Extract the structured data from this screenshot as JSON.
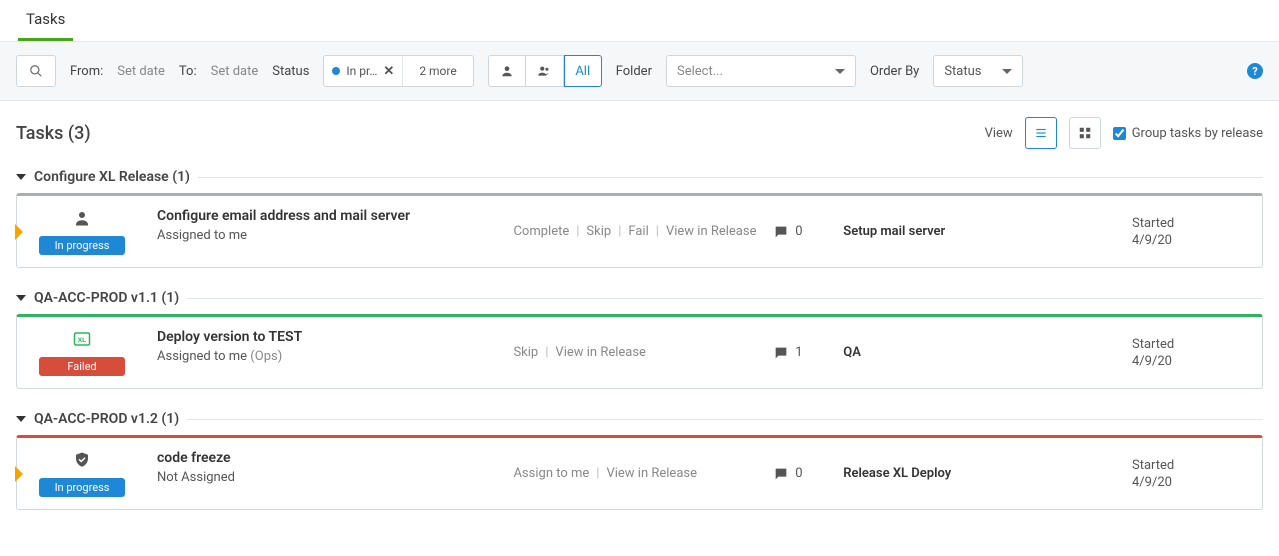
{
  "tab": {
    "label": "Tasks"
  },
  "filters": {
    "from_label": "From:",
    "from_value": "Set date",
    "to_label": "To:",
    "to_value": "Set date",
    "status_label": "Status",
    "status_chip": "In pr…",
    "status_chip_color": "#1e88d6",
    "more_chip": "2 more",
    "assign_all_label": "All",
    "folder_label": "Folder",
    "folder_placeholder": "Select...",
    "orderby_label": "Order By",
    "orderby_value": "Status"
  },
  "heading": {
    "title": "Tasks (3)",
    "view_label": "View",
    "group_checkbox_label": "Group tasks by release",
    "group_checked": true
  },
  "groups": [
    {
      "title": "Configure XL Release (1)",
      "border": "gray",
      "flagged": true,
      "icon": "person",
      "status_text": "In progress",
      "status_class": "in-progress",
      "task_title": "Configure email address and mail server",
      "assigned": "Assigned to me",
      "assigned_extra": "",
      "actions": [
        "Complete",
        "Skip",
        "Fail",
        "View in Release"
      ],
      "comments": "0",
      "phase": "Setup mail server",
      "date_label": "Started",
      "date_value": "4/9/20"
    },
    {
      "title": "QA-ACC-PROD v1.1 (1)",
      "border": "green",
      "flagged": false,
      "icon": "xl",
      "status_text": "Failed",
      "status_class": "failed",
      "task_title": "Deploy version to TEST",
      "assigned": "Assigned to me",
      "assigned_extra": "(Ops)",
      "actions": [
        "Skip",
        "View in Release"
      ],
      "comments": "1",
      "phase": "QA",
      "date_label": "Started",
      "date_value": "4/9/20"
    },
    {
      "title": "QA-ACC-PROD v1.2 (1)",
      "border": "red",
      "flagged": true,
      "icon": "shield",
      "status_text": "In progress",
      "status_class": "in-progress",
      "task_title": "code freeze",
      "assigned": "Not Assigned",
      "assigned_extra": "",
      "actions": [
        "Assign to me",
        "View in Release"
      ],
      "comments": "0",
      "phase": "Release XL Deploy",
      "date_label": "Started",
      "date_value": "4/9/20"
    }
  ]
}
